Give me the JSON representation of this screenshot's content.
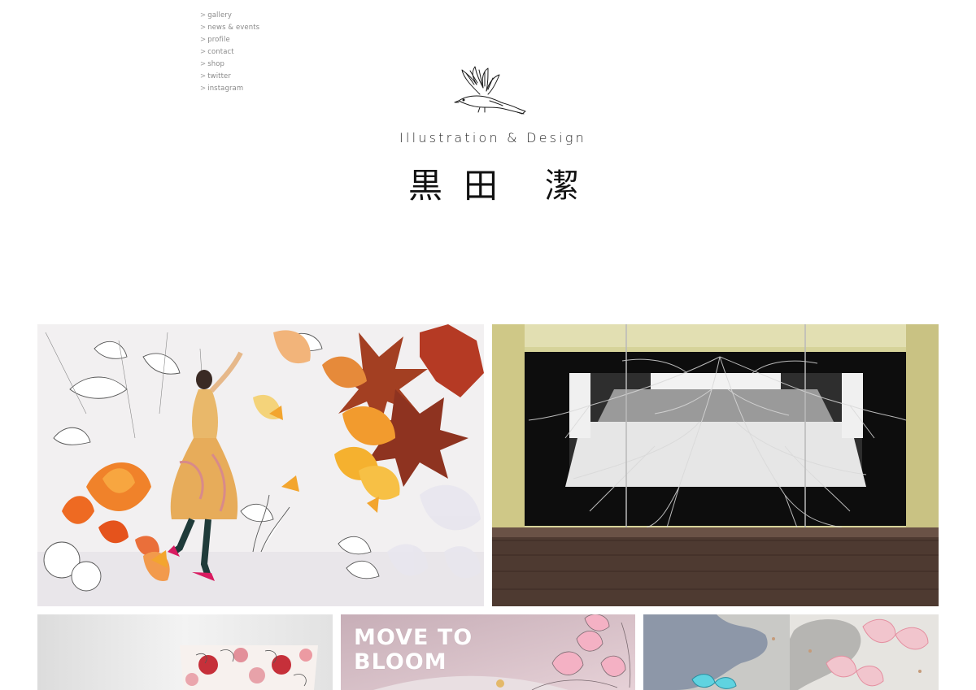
{
  "nav": {
    "arrow": ">",
    "items": [
      {
        "label": "gallery"
      },
      {
        "label": "news & events"
      },
      {
        "label": "profile"
      },
      {
        "label": "contact"
      },
      {
        "label": "shop"
      },
      {
        "label": "twitter"
      },
      {
        "label": "instagram"
      }
    ]
  },
  "header": {
    "logo_icon": "bird-icon",
    "tagline": "Illustration & Design",
    "name_chars": [
      "黒",
      "田",
      "潔"
    ]
  },
  "gallery": {
    "tiles": [
      {
        "name": "autumn-paper-leaves-artwork"
      },
      {
        "name": "window-display-branches-artwork"
      },
      {
        "name": "floral-cushion-artwork"
      },
      {
        "name": "move-to-bloom-artwork",
        "caption": "MOVE TO\nBLOOM"
      },
      {
        "name": "paper-butterflies-artwork"
      }
    ]
  },
  "colors": {
    "nav_text": "#8a8a8a",
    "title_text": "#2a2a2a",
    "background": "#ffffff"
  }
}
